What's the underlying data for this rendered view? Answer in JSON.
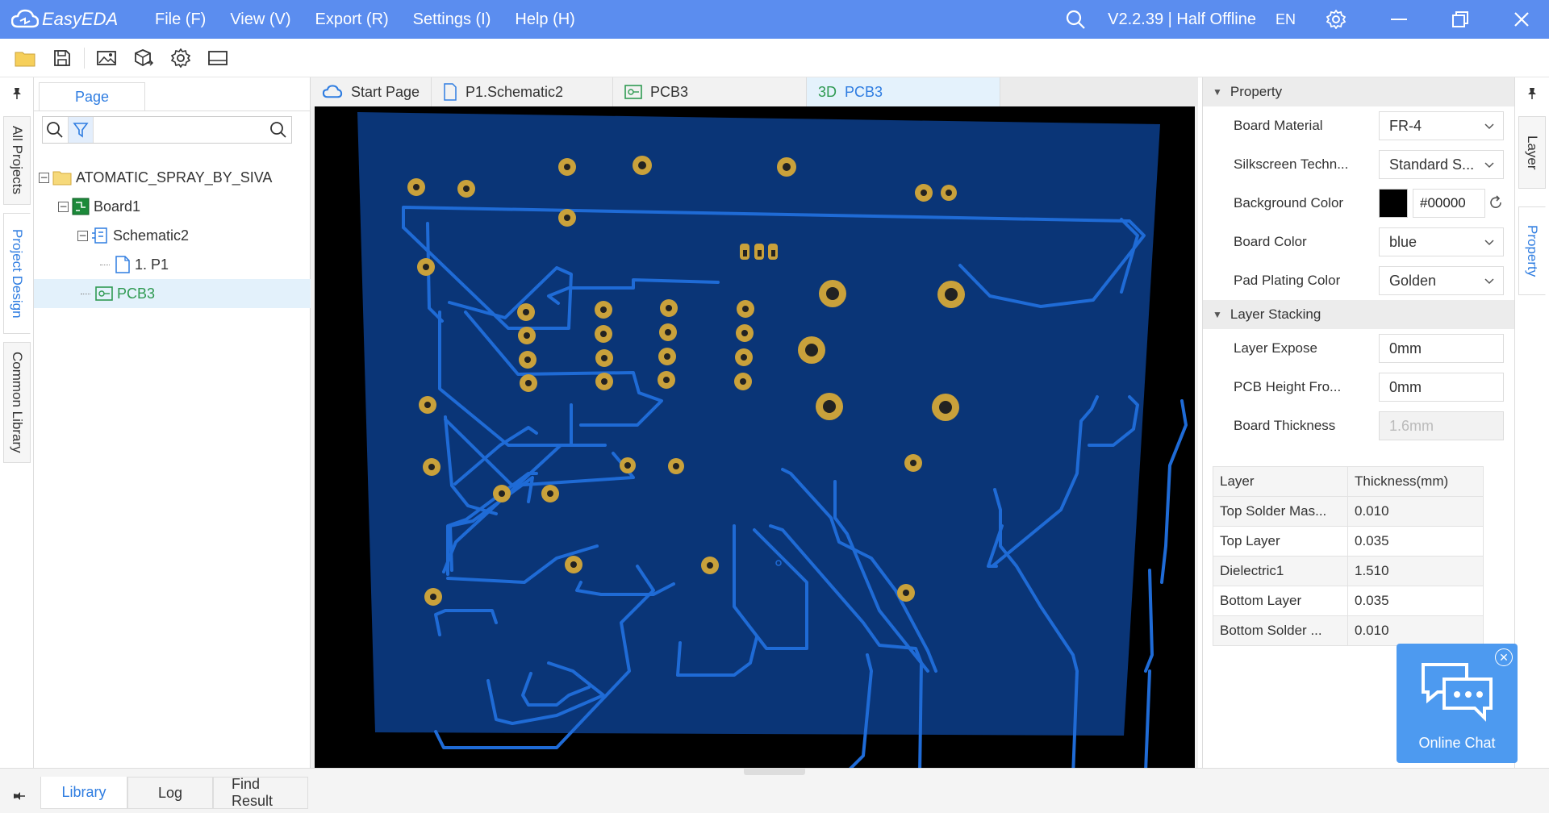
{
  "app": {
    "name": "EasyEDA",
    "menu": [
      "File (F)",
      "View (V)",
      "Export (R)",
      "Settings (I)",
      "Help (H)"
    ],
    "version": "V2.2.39 | Half Offline",
    "language": "EN"
  },
  "left_rail": {
    "tabs": [
      "All Projects",
      "Project Design",
      "Common Library"
    ],
    "active": "Project Design"
  },
  "project_panel": {
    "tab_label": "Page",
    "search_placeholder": "",
    "tree": [
      {
        "label": "ATOMATIC_SPRAY_BY_SIVA",
        "type": "folder-icon",
        "expanded": true
      },
      {
        "label": "Board1",
        "type": "board-icon",
        "expanded": true
      },
      {
        "label": "Schematic2",
        "type": "schematic-icon",
        "expanded": true
      },
      {
        "label": "1. P1",
        "type": "page-icon"
      },
      {
        "label": "PCB3",
        "type": "pcb-icon",
        "selected": true
      }
    ]
  },
  "doc_tabs": [
    {
      "label": "Start Page",
      "icon": "cloud-icon"
    },
    {
      "label": "P1.Schematic2",
      "icon": "document-icon"
    },
    {
      "label": "PCB3",
      "icon": "pcb-icon"
    },
    {
      "label": "PCB3",
      "icon": "3d-label",
      "prefix": "3D",
      "active": true
    }
  ],
  "property_panel": {
    "section1": "Property",
    "board_material": {
      "label": "Board Material",
      "value": "FR-4"
    },
    "silkscreen": {
      "label": "Silkscreen Techn...",
      "value": "Standard S..."
    },
    "background_color": {
      "label": "Background Color",
      "value": "#00000",
      "swatch": "#000000"
    },
    "board_color": {
      "label": "Board Color",
      "value": "blue"
    },
    "pad_plating": {
      "label": "Pad Plating Color",
      "value": "Golden"
    },
    "section2": "Layer Stacking",
    "layer_expose": {
      "label": "Layer Expose",
      "value": "0mm"
    },
    "pcb_height": {
      "label": "PCB Height Fro...",
      "value": "0mm"
    },
    "board_thickness": {
      "label": "Board Thickness",
      "value": "1.6mm"
    },
    "table": {
      "headers": [
        "Layer",
        "Thickness(mm)"
      ],
      "rows": [
        [
          "Top Solder Mas...",
          "0.010"
        ],
        [
          "Top Layer",
          "0.035"
        ],
        [
          "Dielectric1",
          "1.510"
        ],
        [
          "Bottom Layer",
          "0.035"
        ],
        [
          "Bottom Solder ...",
          "0.010"
        ]
      ]
    }
  },
  "right_rail": {
    "tabs": [
      "Layer",
      "Property"
    ],
    "active": "Property"
  },
  "chat_widget": {
    "label": "Online Chat"
  },
  "bottom_tabs": [
    "Library",
    "Log",
    "Find Result"
  ],
  "colors": {
    "titlebar": "#5b8def",
    "accent": "#2f7de1",
    "board": "#0a3577",
    "trace": "#1f6bd6",
    "pad": "#c9a13b"
  }
}
